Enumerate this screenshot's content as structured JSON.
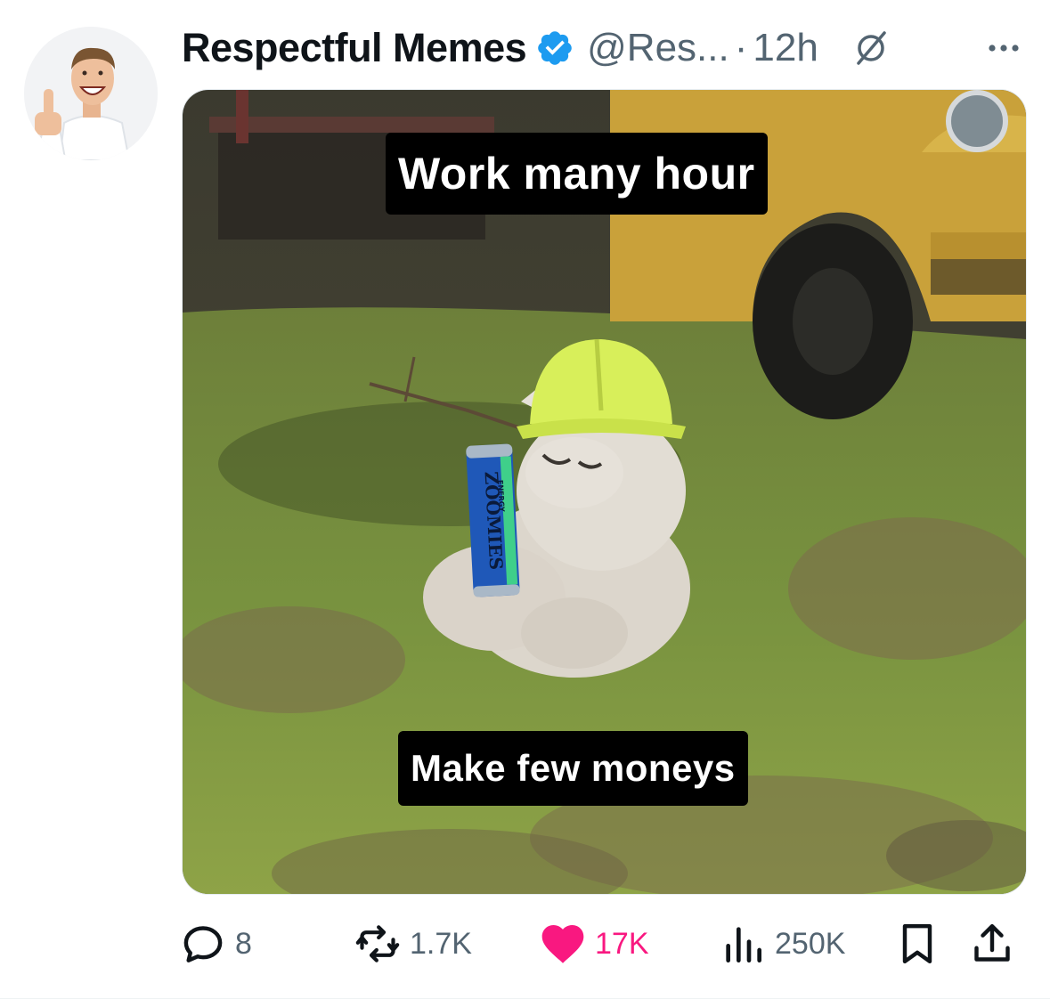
{
  "tweet": {
    "author_name": "Respectful Memes",
    "handle": "@Res...",
    "separator": "·",
    "time": "12h",
    "verified": true
  },
  "media": {
    "caption_top": "Work many hour",
    "caption_bottom": "Make few moneys",
    "can_brand": "ZOOMIES",
    "can_sub": "ENERGY"
  },
  "actions": {
    "replies": "8",
    "reposts": "1.7K",
    "likes": "17K",
    "views": "250K",
    "liked": true
  },
  "colors": {
    "text_primary": "#0f1419",
    "text_secondary": "#536471",
    "verified_blue": "#1d9bf0",
    "like_pink": "#f91880"
  },
  "icons": {
    "reply": "reply-icon",
    "repost": "repost-icon",
    "like": "heart-icon",
    "views": "views-icon",
    "bookmark": "bookmark-icon",
    "share": "share-icon",
    "grok": "grok-icon",
    "more": "more-icon"
  }
}
